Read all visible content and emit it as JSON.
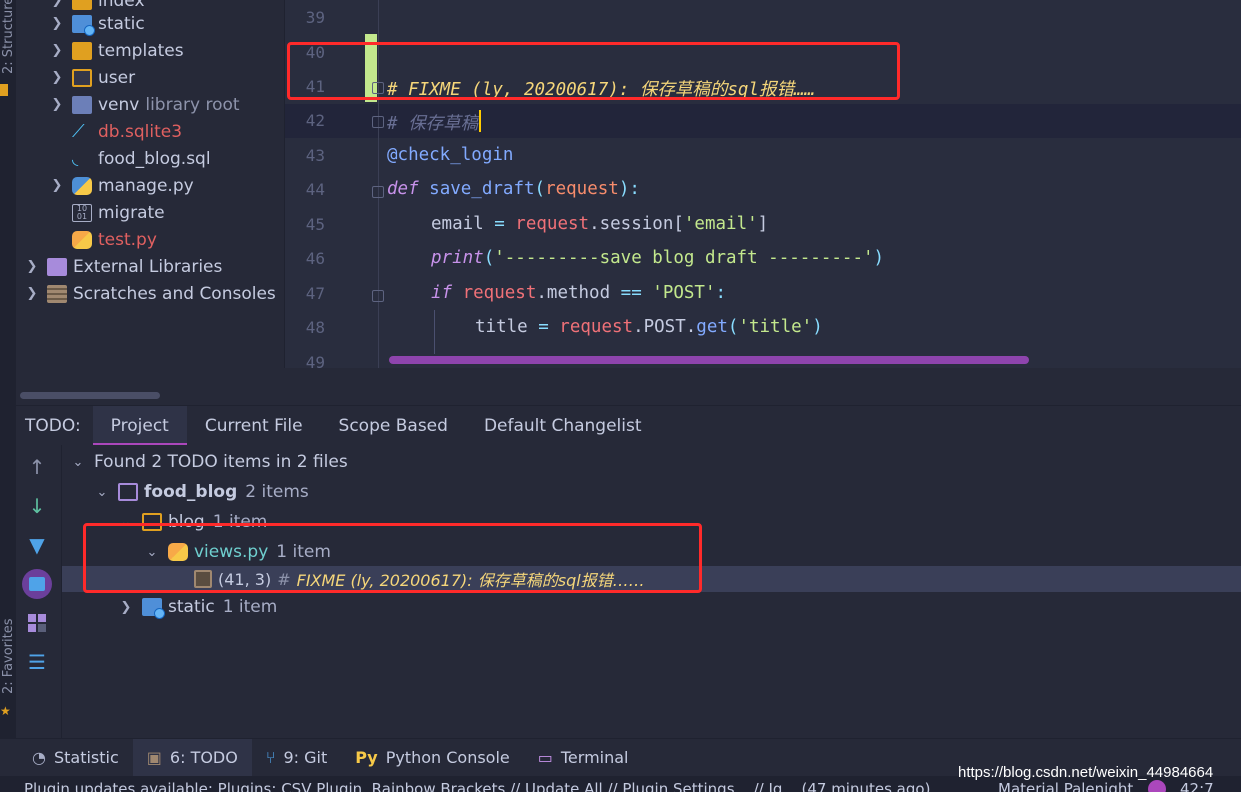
{
  "side_labels": {
    "structure": "2: Structure",
    "favorites": "2: Favorites"
  },
  "project_tree": {
    "items": [
      {
        "label": "index",
        "icon": "folder-icon"
      },
      {
        "label": "static",
        "icon": "web-folder-icon"
      },
      {
        "label": "templates",
        "icon": "templates-folder-icon"
      },
      {
        "label": "user",
        "icon": "module-folder-icon"
      },
      {
        "label": "venv",
        "suffix": "library root",
        "icon": "folder-icon"
      },
      {
        "label": "db.sqlite3",
        "icon": "sqlite-icon"
      },
      {
        "label": "food_blog.sql",
        "icon": "sql-file-icon"
      },
      {
        "label": "manage.py",
        "icon": "python-file-icon"
      },
      {
        "label": "migrate",
        "icon": "binary-file-icon"
      },
      {
        "label": "test.py",
        "icon": "python-file-icon"
      },
      {
        "label": "External Libraries",
        "icon": "library-icon"
      },
      {
        "label": "Scratches and Consoles",
        "icon": "scratches-icon"
      }
    ]
  },
  "editor": {
    "line_numbers": [
      "39",
      "40",
      "41",
      "42",
      "43",
      "44",
      "45",
      "46",
      "47",
      "48",
      "49"
    ],
    "lines": {
      "l41": "# FIXME (ly, 20200617): 保存草稿的sql报错……",
      "l42": "# 保存草稿",
      "l43": "@check_login",
      "l44_kw": "def ",
      "l44_fn": "save_draft",
      "l44_p1": "(",
      "l44_param": "request",
      "l44_p2": "):",
      "l45_a": "email ",
      "l45_op": "= ",
      "l45_var": "request",
      "l45_b": ".session[",
      "l45_str": "'email'",
      "l45_c": "]",
      "l46_kw": "print",
      "l46_a": "(",
      "l46_str": "'---------save blog draft ---------'",
      "l46_b": ")",
      "l47_kw": "if ",
      "l47_var": "request",
      "l47_a": ".method ",
      "l47_op": "== ",
      "l47_str": "'POST'",
      "l47_b": ":",
      "l48_a": "title ",
      "l48_op": "= ",
      "l48_var": "request",
      "l48_b": ".POST.",
      "l48_fn": "get",
      "l48_c": "(",
      "l48_str": "'title'",
      "l48_d": ")"
    }
  },
  "todo": {
    "label": "TODO:",
    "tabs": [
      "Project",
      "Current File",
      "Scope Based",
      "Default Changelist"
    ],
    "summary": "Found 2 TODO items in 2 files",
    "tree": {
      "root": {
        "label": "food_blog",
        "count": "2 items"
      },
      "blog": {
        "label": "blog",
        "count": "1 item"
      },
      "views": {
        "label": "views.py",
        "count": "1 item"
      },
      "item": {
        "pos": "(41, 3)",
        "hash": "#",
        "text": "FIXME (ly, 20200617): 保存草稿的sql报错……"
      },
      "static": {
        "label": "static",
        "count": "1 item"
      }
    }
  },
  "bottom_bar": {
    "statistic": "Statistic",
    "todo": "6: TODO",
    "git": "9: Git",
    "python_console": "Python Console",
    "terminal": "Terminal"
  },
  "status_bar": {
    "message": "Plugin updates available: Plugins: CSV Plugin, Rainbow Brackets // Update All // Plugin Settings... // Ig... (47 minutes ago)",
    "theme": "Material Palenight",
    "position": "42:7"
  },
  "watermark": "https://blog.csdn.net/weixin_44984664",
  "colors": {
    "accent": "#ab47bc",
    "annotation": "#ff2a2a",
    "fixme": "#f5d67a"
  }
}
